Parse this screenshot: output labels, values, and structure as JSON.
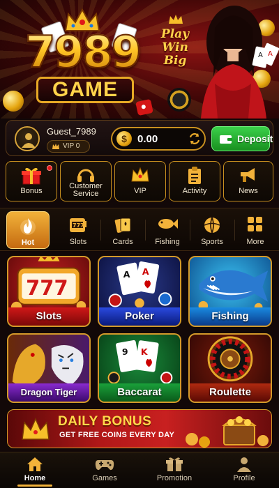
{
  "banner": {
    "logo_number": "7989",
    "logo_word": "GAME",
    "slogan_line1": "Play",
    "slogan_line2": "Win",
    "slogan_line3": "Big"
  },
  "user": {
    "username": "Guest_7989",
    "vip": "VIP 0",
    "balance": "0.00",
    "currency_icon": "$",
    "deposit_label": "Deposit"
  },
  "quick_actions": [
    {
      "label": "Bonus",
      "icon": "gift-icon"
    },
    {
      "label": "Customer Service",
      "icon": "headset-icon"
    },
    {
      "label": "VIP",
      "icon": "crown-icon"
    },
    {
      "label": "Activity",
      "icon": "clipboard-icon"
    },
    {
      "label": "News",
      "icon": "megaphone-icon"
    }
  ],
  "categories": [
    {
      "label": "Hot",
      "icon": "fire-icon",
      "active": true
    },
    {
      "label": "Slots",
      "icon": "slot-machine-icon"
    },
    {
      "label": "Cards",
      "icon": "cards-icon"
    },
    {
      "label": "Fishing",
      "icon": "fish-icon"
    },
    {
      "label": "Sports",
      "icon": "ball-icon"
    },
    {
      "label": "More",
      "icon": "grid-icon"
    }
  ],
  "games": [
    {
      "label": "Slots",
      "icon": "slot-777-icon"
    },
    {
      "label": "Poker",
      "icon": "poker-cards-icon"
    },
    {
      "label": "Fishing",
      "icon": "shark-icon"
    },
    {
      "label": "Dragon Tiger",
      "icon": "dragon-tiger-icon"
    },
    {
      "label": "Baccarat",
      "icon": "baccarat-cards-icon"
    },
    {
      "label": "Roulette",
      "icon": "roulette-icon"
    }
  ],
  "daily_bonus": {
    "title": "DAILY BONUS",
    "subtitle": "GET FREE COINS EVERY DAY"
  },
  "bottom_nav": [
    {
      "label": "Home",
      "icon": "home-icon",
      "active": true
    },
    {
      "label": "Games",
      "icon": "gamepad-icon"
    },
    {
      "label": "Promotion",
      "icon": "gift-icon"
    },
    {
      "label": "Profile",
      "icon": "person-icon"
    }
  ]
}
